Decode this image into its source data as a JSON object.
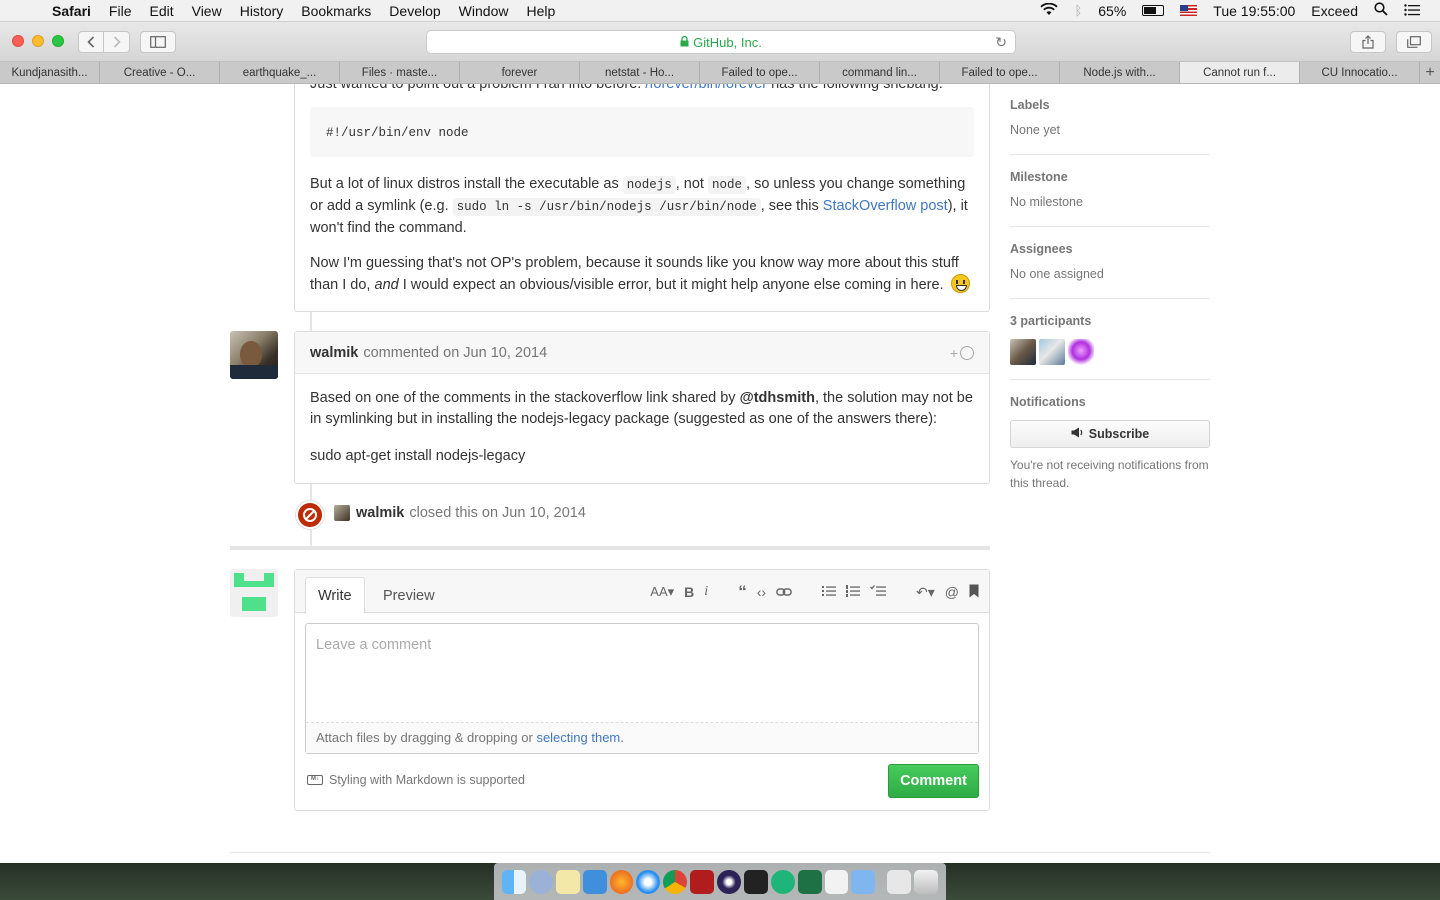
{
  "menubar": {
    "app": "Safari",
    "menus": [
      "File",
      "Edit",
      "View",
      "History",
      "Bookmarks",
      "Develop",
      "Window",
      "Help"
    ],
    "battery": "65%",
    "clock": "Tue 19:55:00",
    "user": "Exceed"
  },
  "toolbar": {
    "address": "GitHub, Inc."
  },
  "tabs": [
    "Kundjanasith...",
    "Creative - O...",
    "earthquake_...",
    "Files · maste...",
    "forever",
    "netstat - Ho...",
    "Failed to ope...",
    "command lin...",
    "Failed to ope...",
    "Node.js with...",
    "Cannot run f...",
    "CU Innocatio..."
  ],
  "active_tab_index": 10,
  "comment1": {
    "top_line_pre": "Just wanted to point out a problem I ran into before.",
    "top_line_link": "/forever/bin/forever",
    "top_line_post": "has the following shebang:",
    "code": "#!/usr/bin/env node",
    "p1_a": "But a lot of linux distros install the executable as",
    "p1_code1": "nodejs",
    "p1_b": ", not",
    "p1_code2": "node",
    "p1_c": ", so unless you change something or add a symlink (e.g.",
    "p1_code3": "sudo ln -s /usr/bin/nodejs /usr/bin/node",
    "p1_d": ", see this",
    "p1_link": "StackOverflow post",
    "p1_e": "), it won't find the command.",
    "p2_a": "Now I'm guessing that's not OP's problem, because it sounds like you know way more about this stuff than I do,",
    "p2_em": "and",
    "p2_b": "I would expect an obvious/visible error, but it might help anyone else coming in here."
  },
  "comment2": {
    "author": "walmik",
    "meta": "commented on Jun 10, 2014",
    "react_plus": "+",
    "p1_a": "Based on one of the comments in the stackoverflow link shared by",
    "p1_mention": "@tdhsmith",
    "p1_b": ", the solution may not be in symlinking but in installing the nodejs-legacy package (suggested as one of the answers there):",
    "p2": "sudo apt-get install nodejs-legacy"
  },
  "closed_event": {
    "author": "walmik",
    "text": "closed this on Jun 10, 2014"
  },
  "new_comment": {
    "tab_write": "Write",
    "tab_preview": "Preview",
    "placeholder": "Leave a comment",
    "attach_pre": "Attach files by dragging & dropping or",
    "attach_link": "selecting them",
    "attach_post": ".",
    "markdown_note": "Styling with Markdown is supported",
    "submit": "Comment"
  },
  "sidebar": {
    "labels_h": "Labels",
    "labels_v": "None yet",
    "milestone_h": "Milestone",
    "milestone_v": "No milestone",
    "assignees_h": "Assignees",
    "assignees_v": "No one assigned",
    "participants_h": "3 participants",
    "notifications_h": "Notifications",
    "subscribe": "Subscribe",
    "notif_note": "You're not receiving notifications from this thread."
  },
  "colors": {
    "link": "#4078c0",
    "closed": "#bd2c00",
    "comment_button": "#2fac45"
  }
}
